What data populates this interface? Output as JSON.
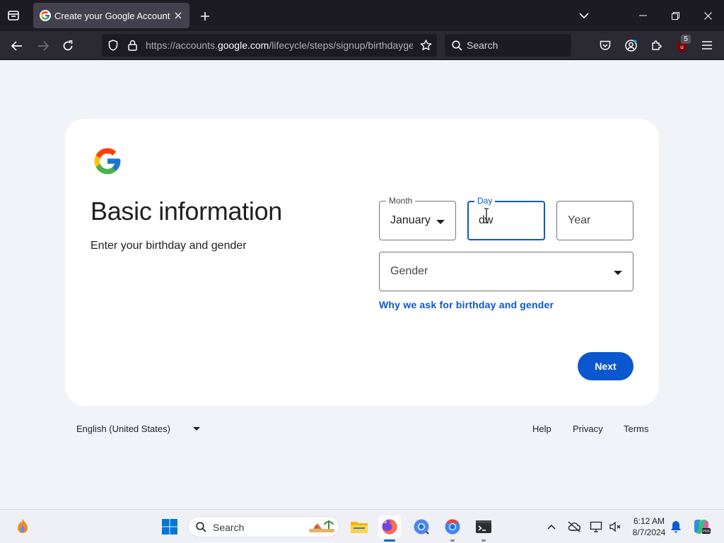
{
  "browser": {
    "tab_title": "Create your Google Account",
    "url_prefix": "https://accounts.",
    "url_host": "google.com",
    "url_suffix": "/lifecycle/steps/signup/birthdaygender",
    "search_placeholder": "Search",
    "extension_badge": "5"
  },
  "card": {
    "title": "Basic information",
    "subtitle": "Enter your birthday and gender",
    "month": {
      "label": "Month",
      "value": "January"
    },
    "day": {
      "label": "Day",
      "value": "dw"
    },
    "year": {
      "placeholder": "Year"
    },
    "gender": {
      "placeholder": "Gender"
    },
    "why_link": "Why we ask for birthday and gender",
    "next_button": "Next"
  },
  "footer": {
    "language": "English (United States)",
    "links": [
      "Help",
      "Privacy",
      "Terms"
    ]
  },
  "taskbar": {
    "search_placeholder": "Search",
    "time": "6:12 AM",
    "date": "8/7/2024"
  },
  "colors": {
    "accent": "#0b57d0",
    "page_background": "#f0f4f9",
    "browser_dark": "#1c1b22",
    "firefox_indicator": "#0067c0"
  },
  "icons": [
    "firefox-view-icon",
    "google-favicon",
    "tab-close-icon",
    "new-tab-icon",
    "tab-list-chevron-icon",
    "minimize-icon",
    "restore-icon",
    "window-close-icon",
    "back-arrow-icon",
    "forward-arrow-icon",
    "reload-icon",
    "shield-icon",
    "lock-icon",
    "bookmark-star-icon",
    "search-icon",
    "pocket-icon",
    "account-icon",
    "extensions-icon",
    "ublock-icon",
    "menu-icon",
    "google-logo",
    "dropdown-arrow-icon",
    "windows-start-icon",
    "file-explorer-icon",
    "firefox-icon",
    "chrome-icon",
    "terminal-icon",
    "notification-bell-icon",
    "copilot-icon"
  ]
}
